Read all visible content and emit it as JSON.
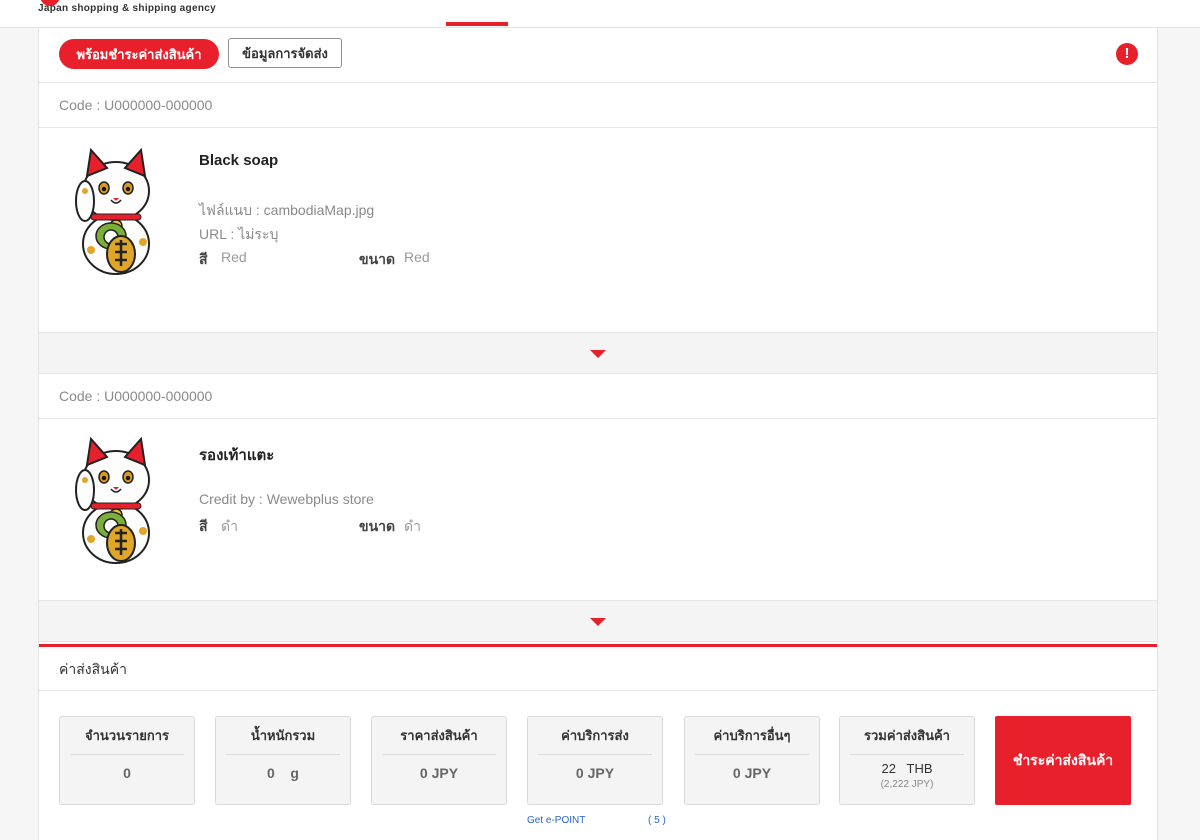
{
  "header": {
    "tagline": "Japan shopping & shipping agency"
  },
  "toolbar": {
    "ready_to_pay": "พร้อมชำระค่าส่งสินค้า",
    "shipping_info": "ข้อมูลการจัดส่ง",
    "alert_glyph": "!"
  },
  "items": [
    {
      "code": "Code : U000000-000000",
      "title": "Black soap",
      "meta_lines": [
        "ไฟล์แนบ : cambodiaMap.jpg",
        "URL : ไม่ระบุ"
      ],
      "color_label": "สี",
      "color_value": "Red",
      "size_label": "ขนาด",
      "size_value": "Red"
    },
    {
      "code": "Code : U000000-000000",
      "title": "รองเท้าแตะ",
      "meta_lines": [
        "Credit by : Wewebplus store"
      ],
      "color_label": "สี",
      "color_value": "ดำ",
      "size_label": "ขนาด",
      "size_value": "ดำ"
    }
  ],
  "summary": {
    "title": "ค่าส่งสินค้า",
    "cards": [
      {
        "label": "จำนวนรายการ",
        "value": "0"
      },
      {
        "label": "น้ำหนักรวม",
        "value": "0    g"
      },
      {
        "label": "ราคาส่งสินค้า",
        "value": "0 JPY"
      },
      {
        "label": "ค่าบริการส่ง",
        "value": "0 JPY"
      },
      {
        "label": "ค่าบริการอื่นๆ",
        "value": "0 JPY"
      },
      {
        "label": "รวมค่าส่งสินค้า",
        "value": "22   THB",
        "sub": "(2,222 JPY)"
      }
    ],
    "pay_button": "ชำระค่าส่งสินค้า",
    "epoint_label": "Get e-POINT",
    "epoint_value": "( 5 )"
  },
  "colors": {
    "accent": "#e8202b"
  }
}
